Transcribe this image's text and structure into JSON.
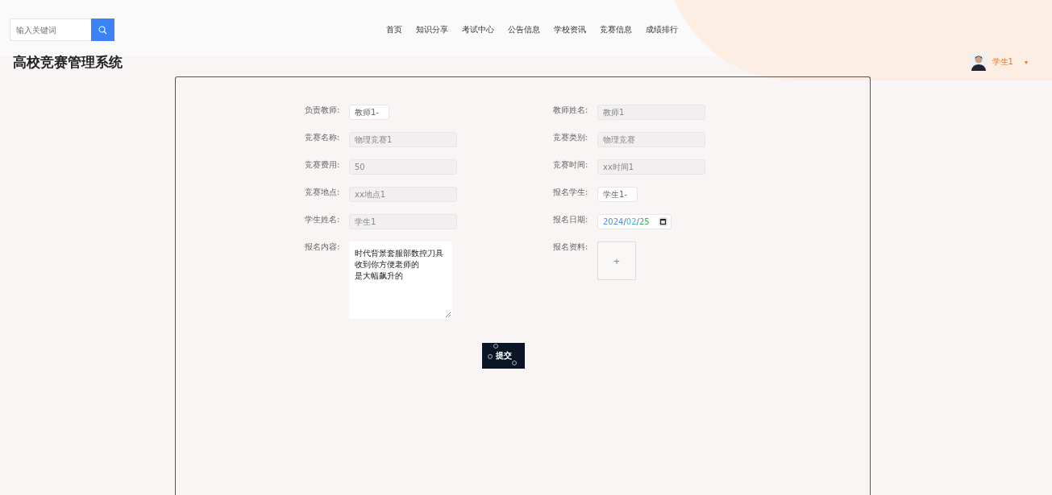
{
  "search": {
    "placeholder": "输入关键词"
  },
  "nav": [
    {
      "label": "首页"
    },
    {
      "label": "知识分享"
    },
    {
      "label": "考试中心"
    },
    {
      "label": "公告信息"
    },
    {
      "label": "学校资讯"
    },
    {
      "label": "竞赛信息"
    },
    {
      "label": "成绩排行"
    }
  ],
  "site_title": "高校竞赛管理系统",
  "user": {
    "name": "学生1",
    "caret": "▾"
  },
  "form": {
    "fields": [
      {
        "label": "负责教师:",
        "kind": "select",
        "value": "教师1-"
      },
      {
        "label": "教师姓名:",
        "kind": "text",
        "value": "教师1",
        "disabled": true
      },
      {
        "label": "竞赛名称:",
        "kind": "text",
        "value": "物理竞赛1",
        "disabled": true
      },
      {
        "label": "竞赛类别:",
        "kind": "text",
        "value": "物理竞赛",
        "disabled": true
      },
      {
        "label": "竞赛费用:",
        "kind": "text",
        "value": "50",
        "disabled": true
      },
      {
        "label": "竞赛时间:",
        "kind": "text",
        "value": "xx时间1",
        "disabled": true
      },
      {
        "label": "竞赛地点:",
        "kind": "text",
        "value": "xx地点1",
        "disabled": true
      },
      {
        "label": "报名学生:",
        "kind": "select",
        "value": "学生1-"
      },
      {
        "label": "学生姓名:",
        "kind": "text",
        "value": "学生1",
        "disabled": true
      },
      {
        "label": "报名日期:",
        "kind": "date",
        "value": "2024/02/25"
      },
      {
        "label": "报名内容:",
        "kind": "textarea",
        "lines": [
          "时代背景套服部数控刀具",
          "收到你方便老师的",
          "是大幅飙升的"
        ]
      },
      {
        "label": "报名资料:",
        "kind": "upload",
        "value": "+"
      }
    ],
    "submit": "提交"
  }
}
